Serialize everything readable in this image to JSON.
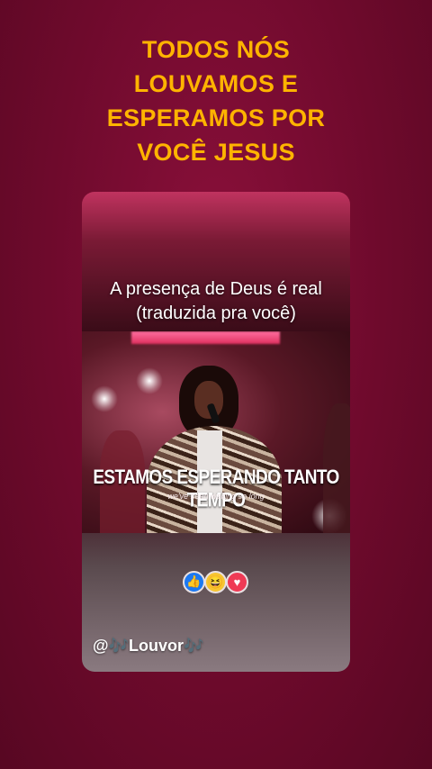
{
  "headline": {
    "lines": [
      "TODOS NÓS",
      "LOUVAMOS E",
      "ESPERAMOS POR",
      "VOCÊ JESUS"
    ],
    "color": "#ffb400"
  },
  "card": {
    "caption_lines": [
      "A presença de Deus é real",
      "(traduzida pra você)"
    ],
    "video": {
      "subtitle_pt": "ESTAMOS ESPERANDO TANTO TEMPO",
      "subtitle_en": "we've been waiting so long"
    },
    "reactions": [
      {
        "name": "like-icon",
        "glyph": "👍",
        "color": "#1c79f2"
      },
      {
        "name": "haha-icon",
        "glyph": "😆",
        "color": "#f7c531"
      },
      {
        "name": "love-icon",
        "glyph": "♥",
        "color": "#ef3a55"
      }
    ],
    "handle": {
      "prefix": "@",
      "note": "🎶",
      "name": "Louvor",
      "note_end": "🎶"
    }
  }
}
